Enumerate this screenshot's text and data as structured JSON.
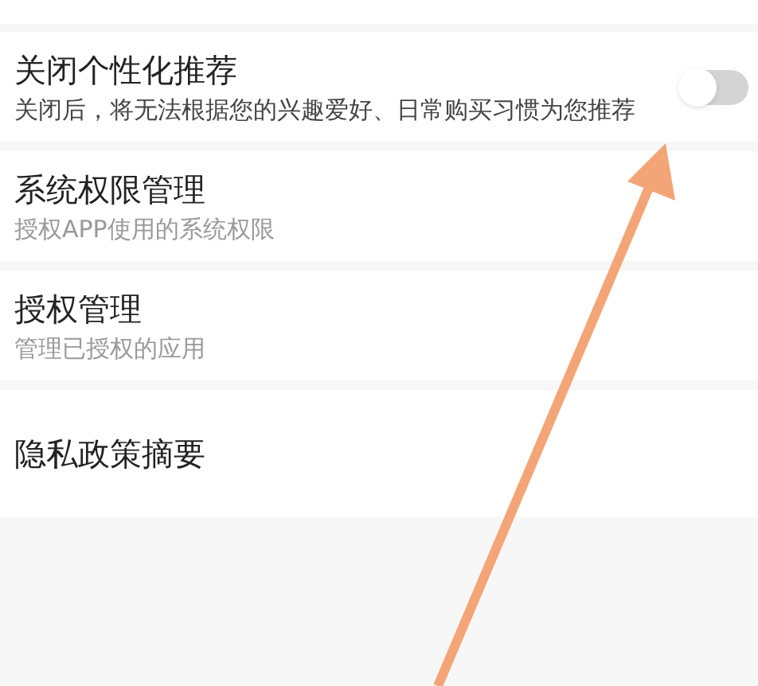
{
  "settings": [
    {
      "title": "关闭个性化推荐",
      "subtitle": "关闭后，将无法根据您的兴趣爱好、日常购买习惯为您推荐",
      "kind": "toggle",
      "on": false
    },
    {
      "title": "系统权限管理",
      "subtitle": "授权APP使用的系统权限",
      "kind": "link"
    },
    {
      "title": "授权管理",
      "subtitle": "管理已授权的应用",
      "kind": "link"
    },
    {
      "title": "隐私政策摘要",
      "kind": "link"
    }
  ]
}
